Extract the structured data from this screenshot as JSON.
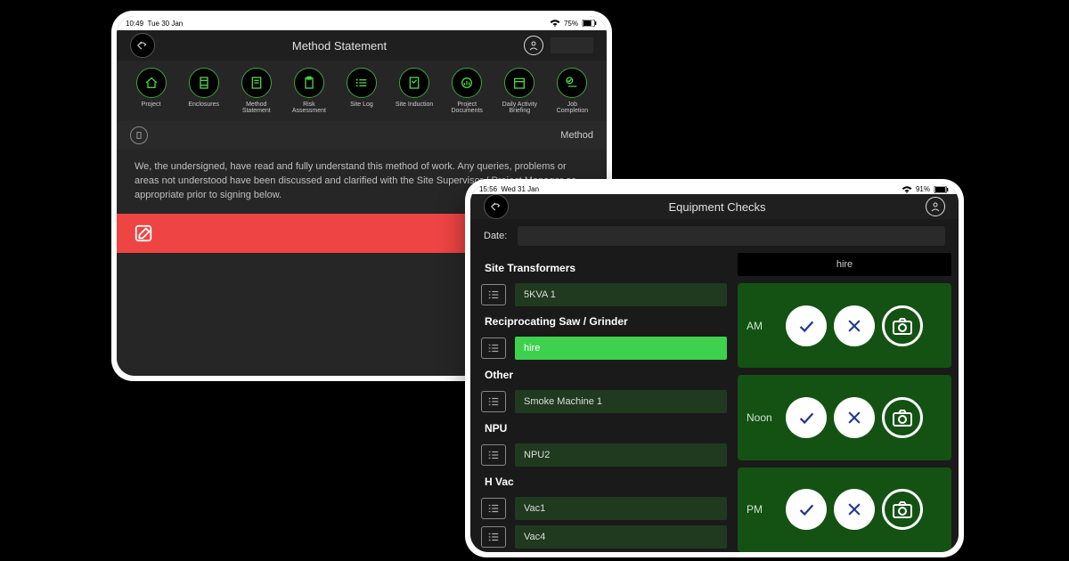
{
  "tablet1": {
    "status": {
      "time": "10:49",
      "day": "Tue 30 Jan",
      "battery": "75%"
    },
    "header": {
      "title": "Method Statement"
    },
    "nav": [
      {
        "label": "Project"
      },
      {
        "label": "Enclosures"
      },
      {
        "label": "Method Statement"
      },
      {
        "label": "Risk Assessment"
      },
      {
        "label": "Site Log"
      },
      {
        "label": "Site Induction"
      },
      {
        "label": "Project Documents"
      },
      {
        "label": "Daily Activity Briefing"
      },
      {
        "label": "Job Completion"
      }
    ],
    "subhead": "Method",
    "statement": "We, the undersigned, have read and fully understand this method of work. Any queries, problems or areas not understood have been discussed and clarified with the Site Supervisor / Project Manager as appropriate prior to signing below."
  },
  "tablet2": {
    "status": {
      "time": "15:56",
      "day": "Wed 31 Jan",
      "battery": "91%"
    },
    "header": {
      "title": "Equipment Checks"
    },
    "date_label": "Date:",
    "right_header": "hire",
    "sections": [
      {
        "title": "Site Transformers",
        "items": [
          "5KVA 1"
        ]
      },
      {
        "title": "Reciprocating Saw / Grinder",
        "items": [
          "hire"
        ],
        "highlight": 0
      },
      {
        "title": "Other",
        "items": [
          "Smoke Machine 1"
        ]
      },
      {
        "title": "NPU",
        "items": [
          "NPU2"
        ]
      },
      {
        "title": "H Vac",
        "items": [
          "Vac1",
          "Vac4"
        ]
      }
    ],
    "slots": [
      "AM",
      "Noon",
      "PM"
    ]
  }
}
